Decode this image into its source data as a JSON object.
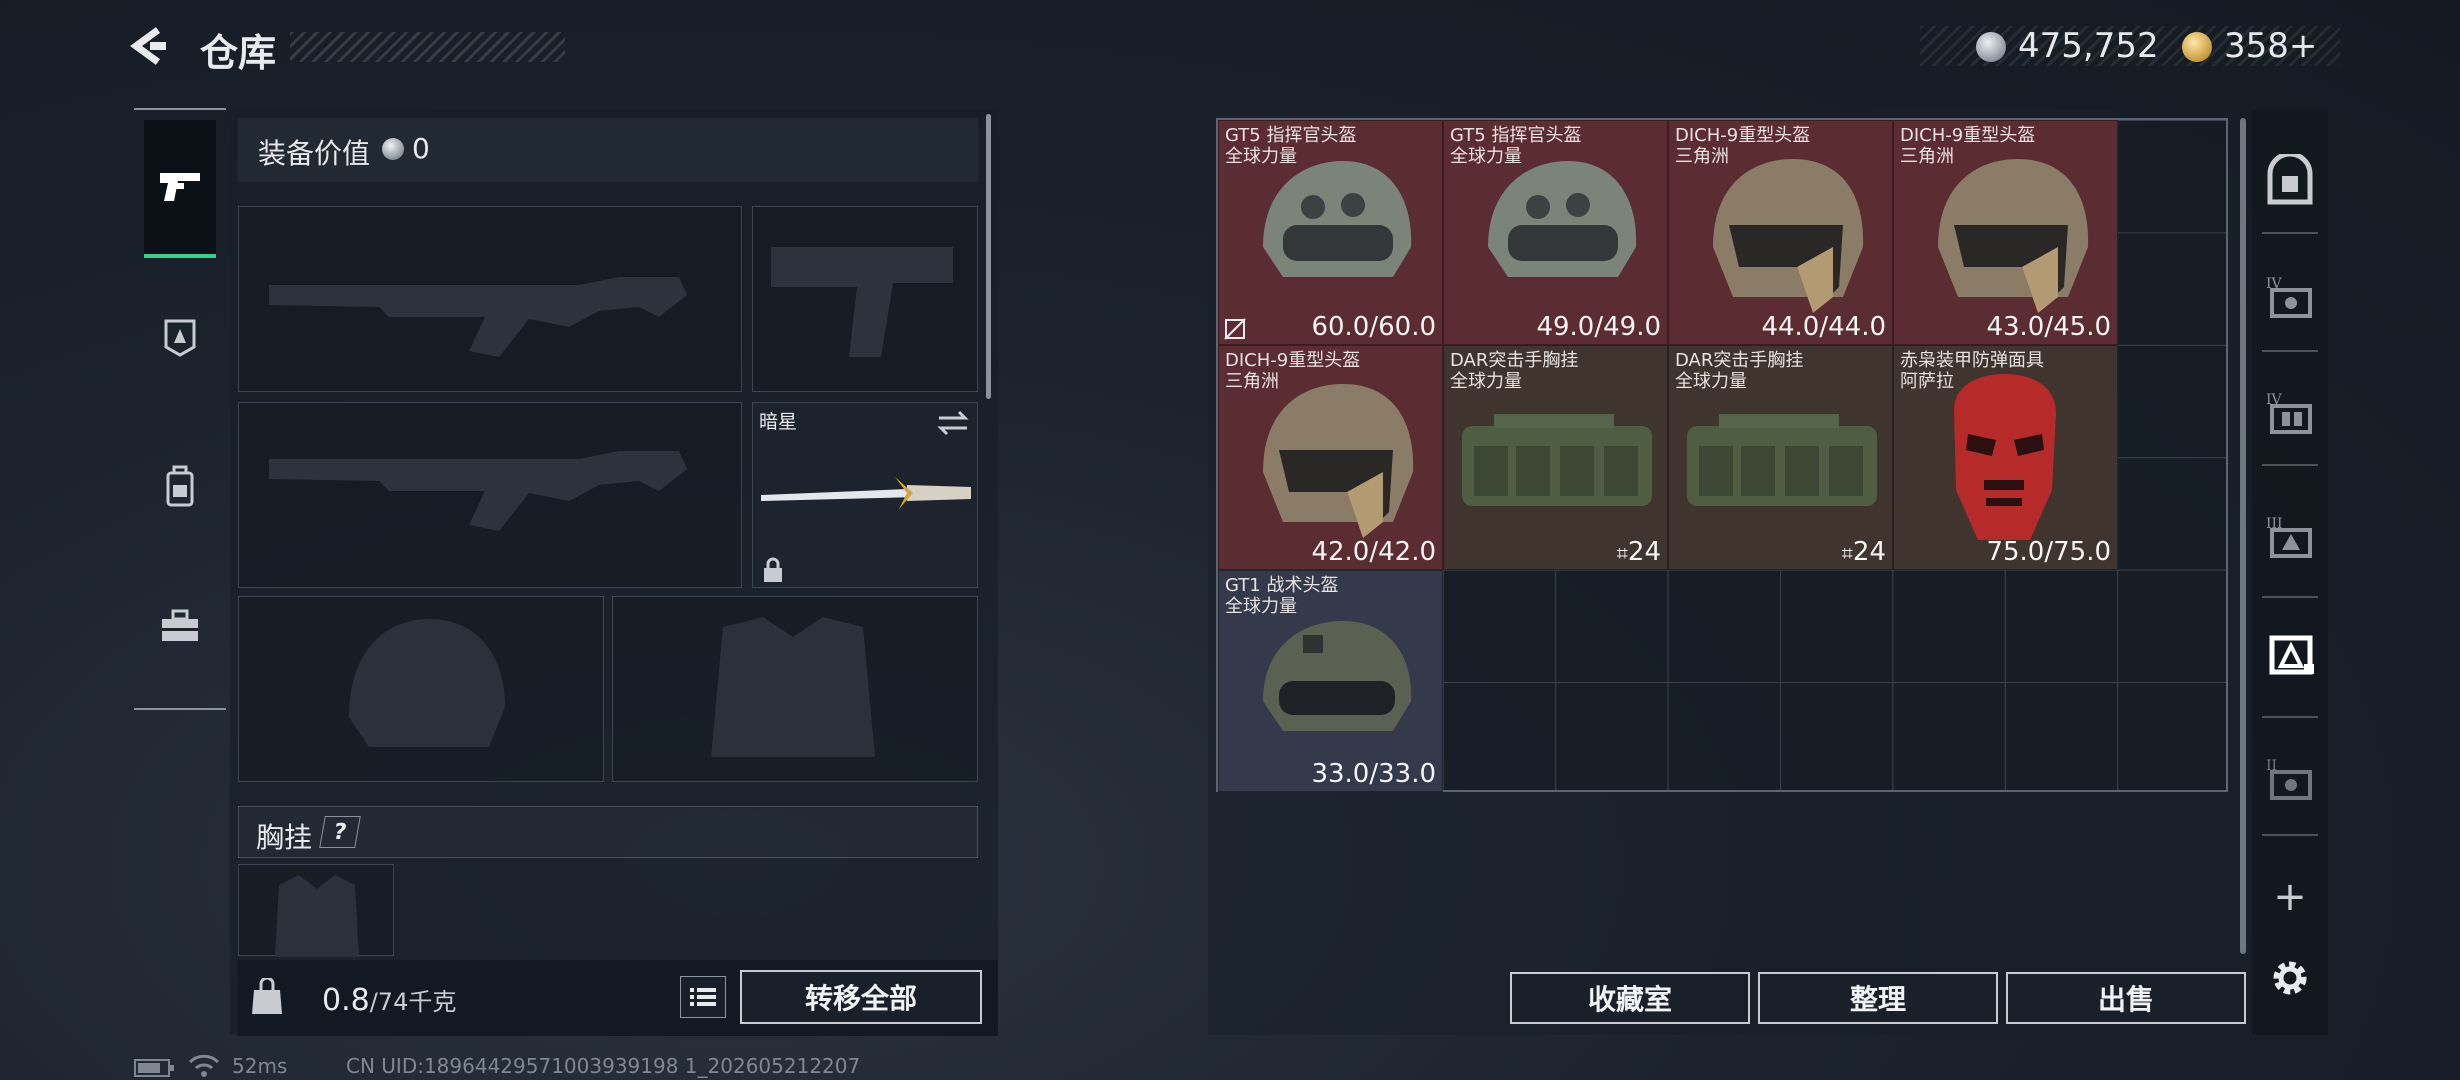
{
  "header": {
    "title": "仓库",
    "currency_silver": "475,752",
    "currency_gold": "358+"
  },
  "left_nav": [
    "weapon-pistol-icon",
    "armor-badge-icon",
    "backpack-icon",
    "toolbox-icon"
  ],
  "loadout": {
    "equipment_value_label": "装备价值",
    "equipment_value": "0",
    "melee_name": "暗星",
    "chest_rig_label": "胸挂",
    "chest_rig_help": "?",
    "weight_value": "0.8",
    "weight_max": "/74千克",
    "transfer_all": "转移全部"
  },
  "storage": {
    "items": [
      {
        "name": "GT5 指挥官头盔",
        "sub": "全球力量",
        "durability": "60.0/60.0",
        "no_repair": true
      },
      {
        "name": "GT5 指挥官头盔",
        "sub": "全球力量",
        "durability": "49.0/49.0"
      },
      {
        "name": "DICH-9重型头盔",
        "sub": "三角洲",
        "durability": "44.0/44.0"
      },
      {
        "name": "DICH-9重型头盔",
        "sub": "三角洲",
        "durability": "43.0/45.0"
      },
      {
        "name": "DICH-9重型头盔",
        "sub": "三角洲",
        "durability": "42.0/42.0"
      },
      {
        "name": "DAR突击手胸挂",
        "sub": "全球力量",
        "capacity": "24"
      },
      {
        "name": "DAR突击手胸挂",
        "sub": "全球力量",
        "capacity": "24"
      },
      {
        "name": "赤枭装甲防弹面具",
        "sub": "阿萨拉",
        "durability": "75.0/75.0"
      },
      {
        "name": "GT1 战术头盔",
        "sub": "全球力量",
        "durability": "33.0/33.0"
      }
    ],
    "buttons": {
      "collection": "收藏室",
      "organize": "整理",
      "sell": "出售"
    }
  },
  "right_sidebar": [
    "safe-icon",
    "storage-page-4a-icon",
    "storage-page-4b-icon",
    "storage-page-3-icon",
    "storage-page-active-icon",
    "storage-page-2-icon",
    "add-page-icon",
    "settings-icon"
  ],
  "status_bar": {
    "ping": "52ms",
    "uid": "CN UID:18964429571003939198 1_202605212207"
  },
  "colors": {
    "accent_green": "#39d08e",
    "rarity_red": "#5b2c32",
    "rarity_brown": "#3f342e",
    "rarity_gray": "#343a4c"
  }
}
